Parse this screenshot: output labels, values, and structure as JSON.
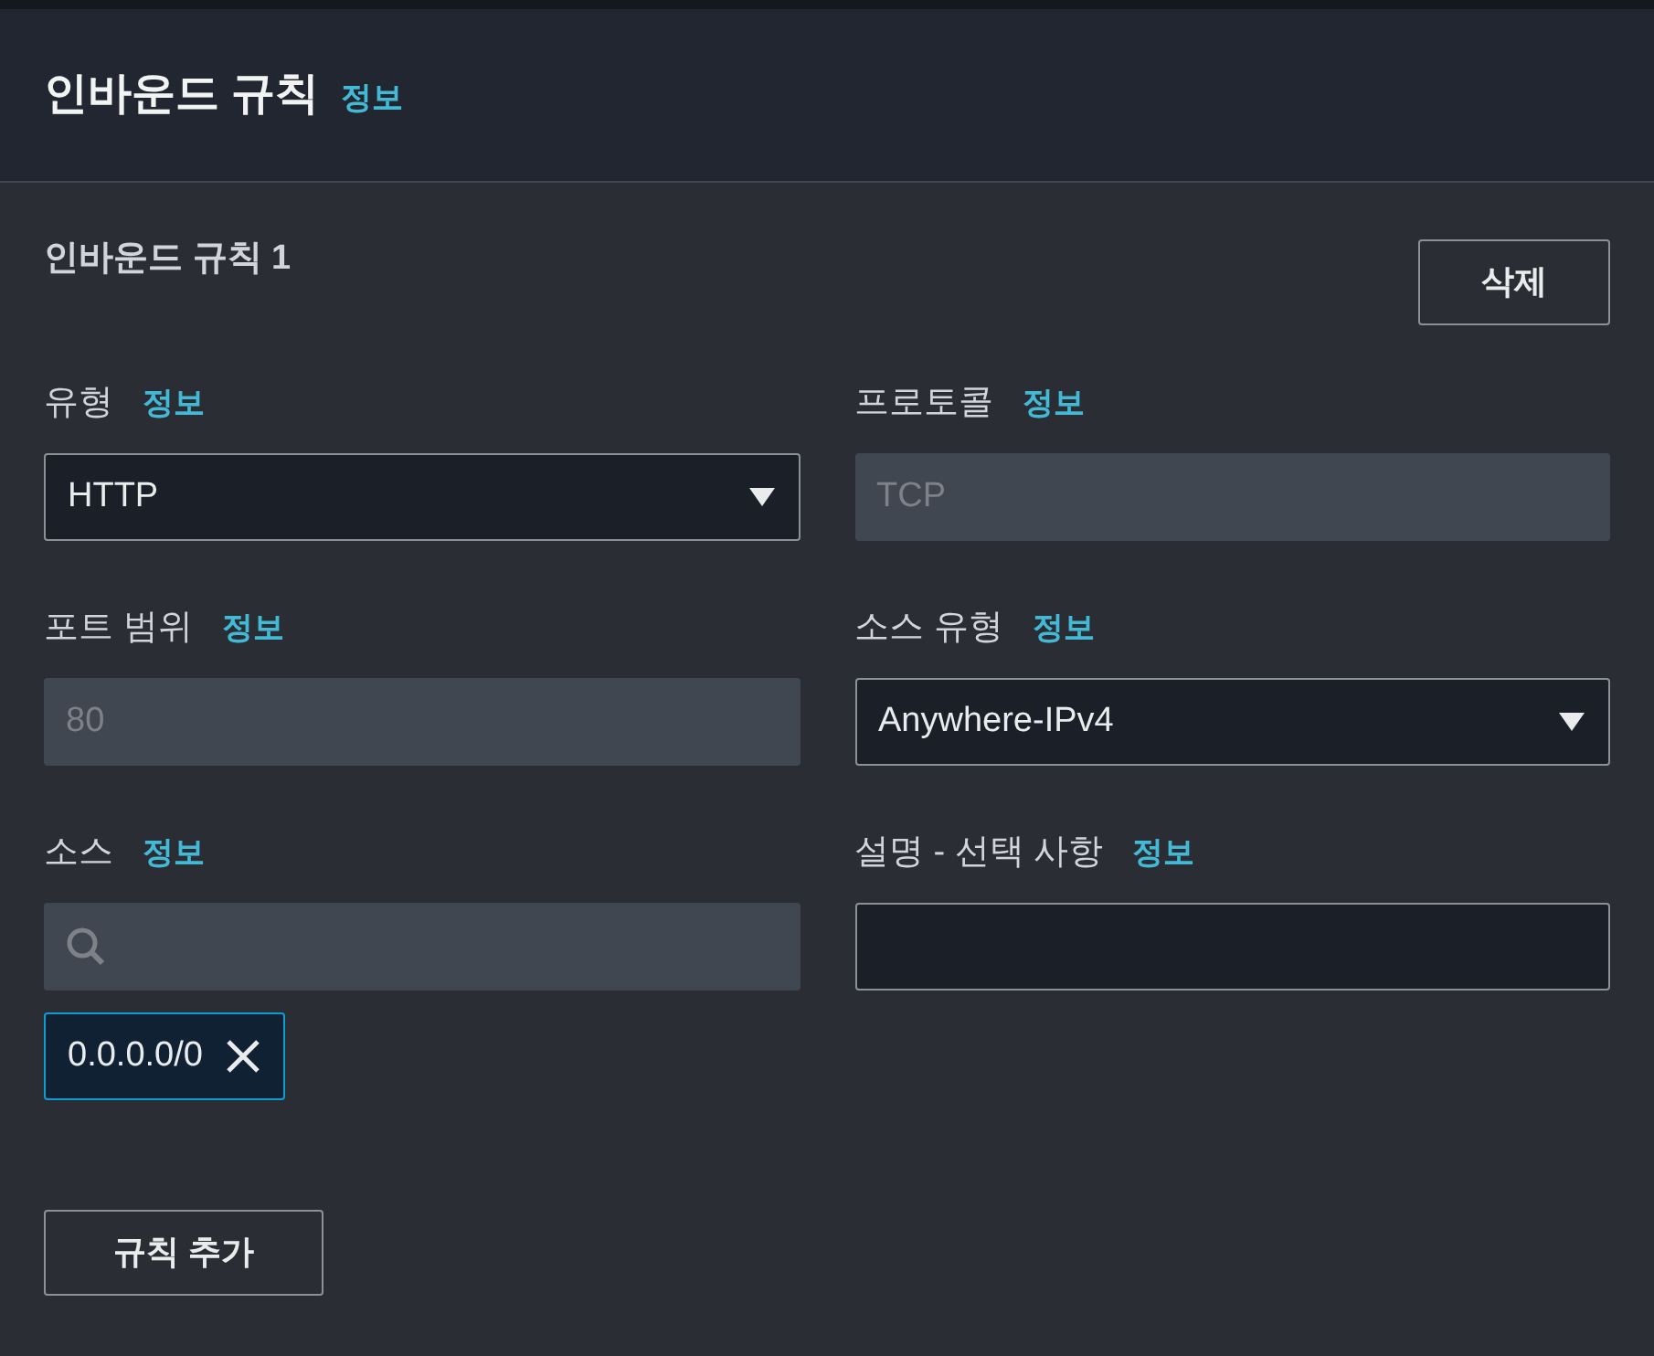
{
  "header": {
    "title": "인바운드 규칙",
    "info": "정보"
  },
  "rule": {
    "title": "인바운드 규칙 1",
    "delete_button": "삭제",
    "fields": [
      {
        "label": "유형",
        "info": "정보",
        "kind": "select",
        "value": "HTTP",
        "disabled": false
      },
      {
        "label": "프로토콜",
        "info": "정보",
        "kind": "text",
        "value": "TCP",
        "disabled": true
      },
      {
        "label": "포트 범위",
        "info": "정보",
        "kind": "text",
        "value": "80",
        "disabled": true
      },
      {
        "label": "소스 유형",
        "info": "정보",
        "kind": "select",
        "value": "Anywhere-IPv4",
        "disabled": false
      },
      {
        "label": "소스",
        "info": "정보",
        "kind": "search",
        "tokens": [
          "0.0.0.0/0"
        ]
      },
      {
        "label": "설명 - 선택 사항",
        "info": "정보",
        "kind": "text",
        "disabled": false
      }
    ]
  },
  "add_rule_button": "규칙 추가"
}
